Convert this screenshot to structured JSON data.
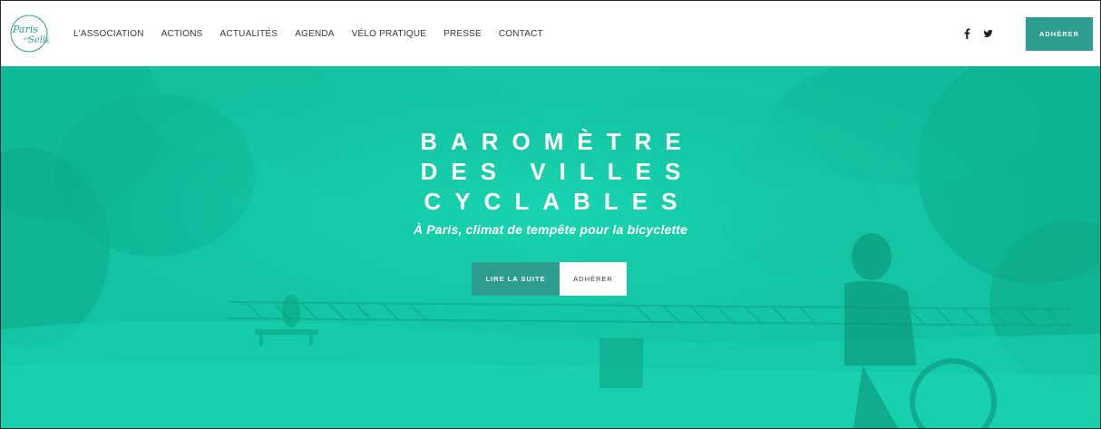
{
  "header": {
    "logo_text": "Paris en Selle",
    "nav": [
      {
        "label": "L'ASSOCIATION"
      },
      {
        "label": "ACTIONS"
      },
      {
        "label": "ACTUALITÉS"
      },
      {
        "label": "AGENDA"
      },
      {
        "label": "VÉLO PRATIQUE"
      },
      {
        "label": "PRESSE"
      },
      {
        "label": "CONTACT"
      }
    ],
    "social": [
      "facebook-icon",
      "twitter-icon"
    ],
    "cta_label": "ADHÉRER"
  },
  "hero": {
    "title_lines": [
      "BAROMÈTRE",
      "DES VILLES",
      "CYCLABLES"
    ],
    "subtitle": "À Paris, climat de tempête pour la bicyclette",
    "primary_label": "LIRE LA SUITE",
    "secondary_label": "ADHÉRER"
  },
  "colors": {
    "accent": "#2d9d8f",
    "hero_overlay": "#15c9a6"
  }
}
